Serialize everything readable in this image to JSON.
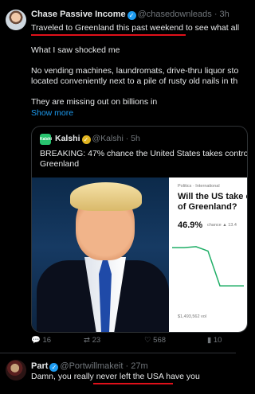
{
  "post": {
    "author_name": "Chase Passive Income",
    "handle": "@chasedownleads",
    "time": "· 3h",
    "line1": "Traveled to Greenland this past weekend to see what all",
    "line2": "What I saw shocked me",
    "line3": "No vending machines, laundromats, drive-thru liquor sto",
    "line4": "located conveniently next to a pile of rusty old nails in th",
    "line5": "They are missing out on billions in",
    "show_more": "Show more"
  },
  "quote": {
    "logo_text": "Kalshi",
    "author_name": "Kalshi",
    "handle": "@Kalshi",
    "time": "· 5h",
    "text_line1": "BREAKING: 47% chance the United States takes contro",
    "text_line2": "Greenland",
    "panel": {
      "breadcrumb": "Politics · International",
      "title_line1": "Will the US take c",
      "title_line2": "of Greenland?",
      "percent": "46.9%",
      "sub": "chance ▲ 13.4",
      "volume": "$1,493,562 vol"
    },
    "chart_data": {
      "type": "line",
      "series": [
        {
          "values": [
            46.9,
            46.9,
            47.2,
            45.8,
            34.6,
            34.6,
            34.6
          ]
        }
      ]
    }
  },
  "actions": {
    "replies": "16",
    "reposts": "23",
    "likes": "568",
    "views": "10"
  },
  "reply": {
    "author_name": "Part",
    "handle": "@Portwillmakeit",
    "time": "· 27m",
    "text": "Damn, you really never left the USA have you"
  },
  "colors": {
    "accent": "#1d9bf0",
    "underline": "#e0101a",
    "kalshi": "#28c46f",
    "chart_line": "#1fae66"
  }
}
